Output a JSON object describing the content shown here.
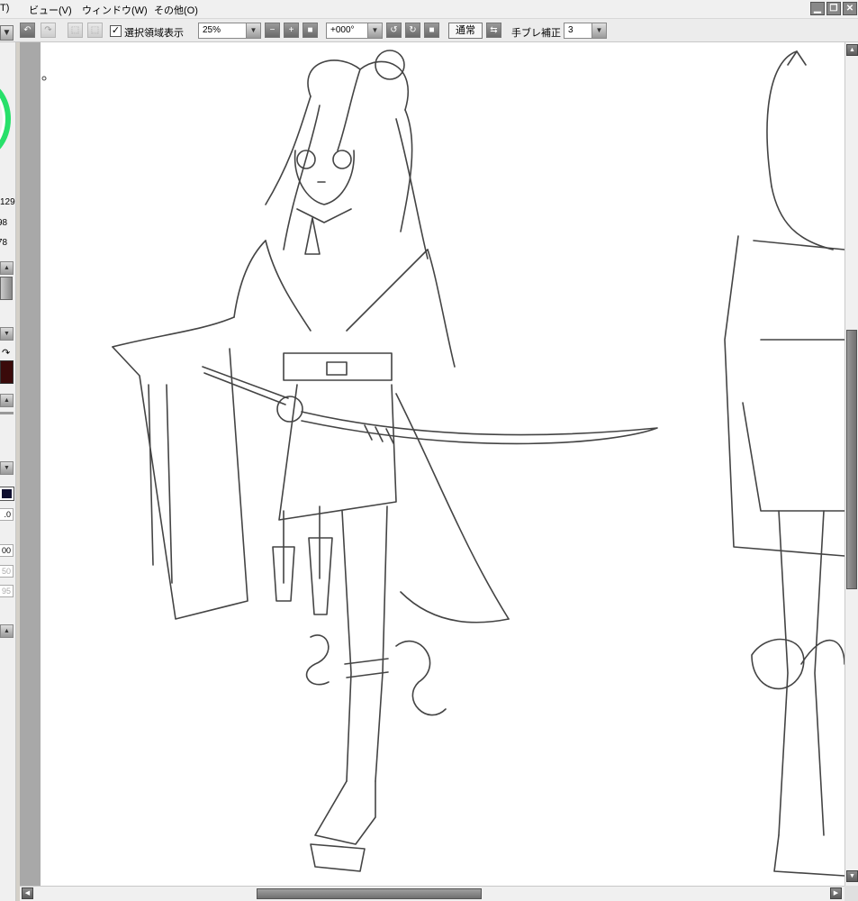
{
  "menubar": {
    "menu_fragment": "T)",
    "menus": [
      "ビュー(V)",
      "ウィンドウ(W)",
      "その他(O)"
    ],
    "window_buttons": [
      "minimize-icon",
      "restore-icon",
      "close-icon"
    ]
  },
  "toolbar": {
    "show_selection_label": "選択領域表示",
    "show_selection_checked": true,
    "zoom_value": "25%",
    "rotation_value": "+000°",
    "blend_mode": "通常",
    "stabilizer_label": "手ブレ補正",
    "stabilizer_value": "3"
  },
  "leftpanel": {
    "values": [
      "129",
      "98",
      "78"
    ],
    "fields": [
      ".0",
      "00",
      "50",
      "95"
    ],
    "color_swatch": "#3a0a0a",
    "secondary_swatch": "#101030"
  },
  "canvas": {
    "background": "#a8a8a8",
    "paper": "#ffffff"
  }
}
